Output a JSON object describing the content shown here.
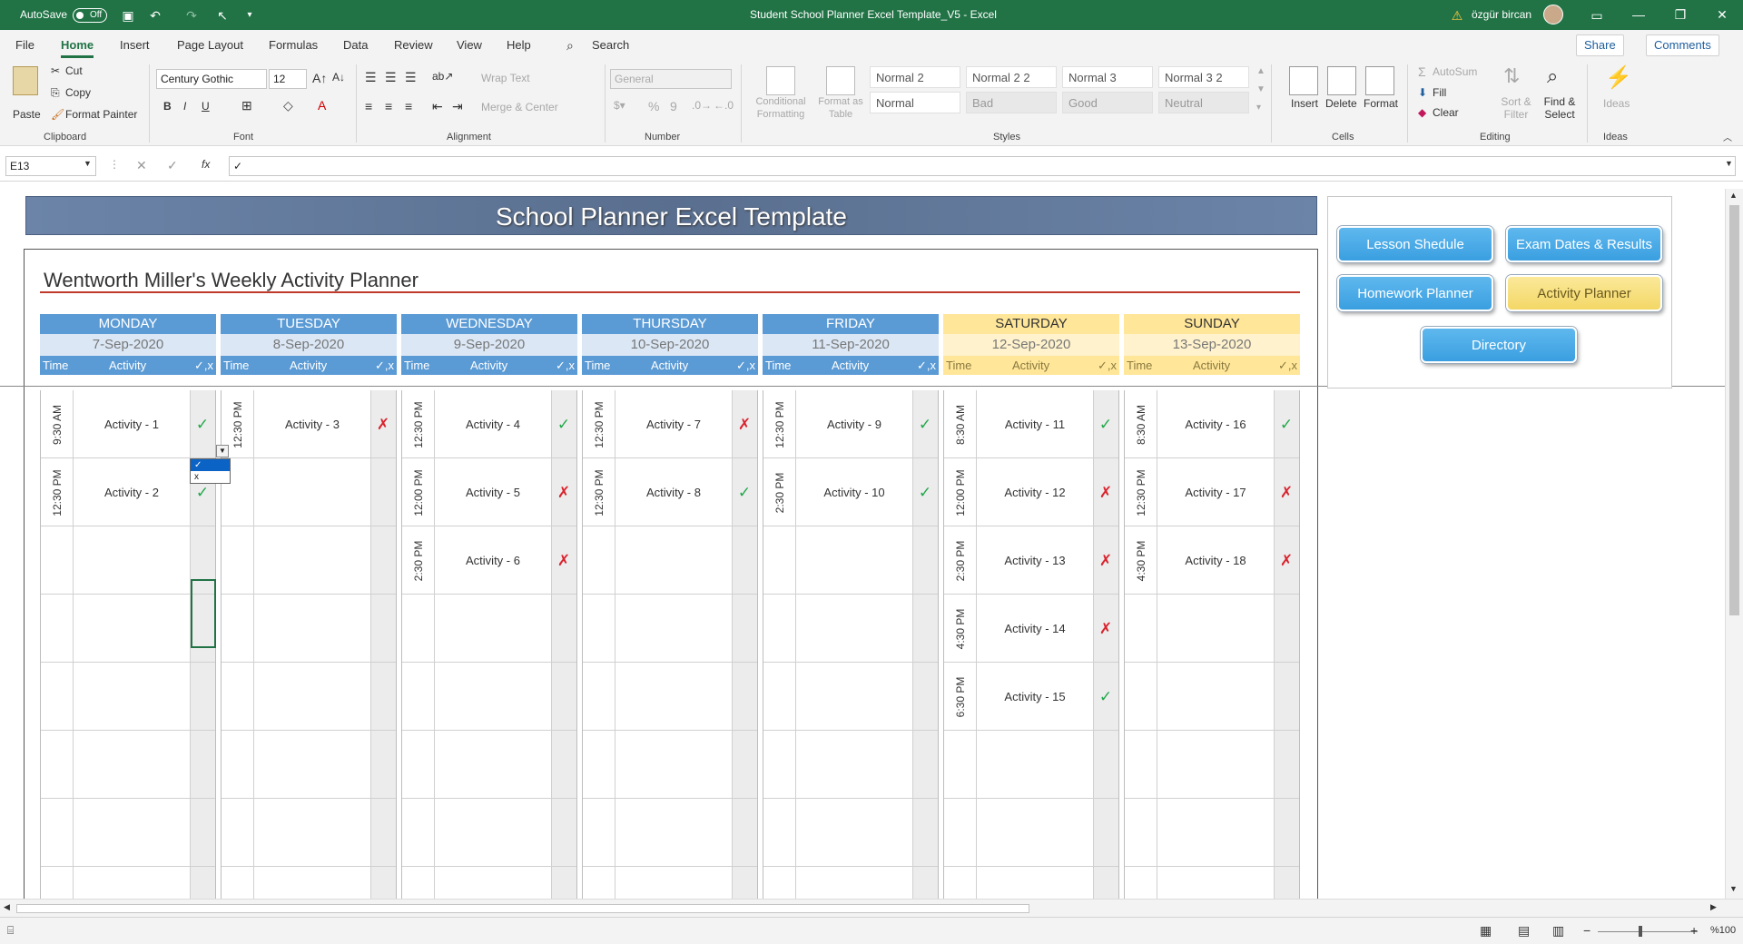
{
  "titlebar": {
    "autosave": "AutoSave",
    "toggle": "Off",
    "title": "Student School Planner Excel Template_V5  -  Excel",
    "user": "özgür bircan"
  },
  "menu": [
    "File",
    "Home",
    "Insert",
    "Page Layout",
    "Formulas",
    "Data",
    "Review",
    "View",
    "Help"
  ],
  "search": "Search",
  "share": "Share",
  "comments": "Comments",
  "ribbon": {
    "clipboard": {
      "paste": "Paste",
      "cut": "Cut",
      "copy": "Copy",
      "painter": "Format Painter",
      "label": "Clipboard"
    },
    "font": {
      "name": "Century Gothic",
      "size": "12",
      "label": "Font",
      "bold": "B",
      "italic": "I",
      "underline": "U"
    },
    "alignment": {
      "wrap": "Wrap Text",
      "merge": "Merge & Center",
      "label": "Alignment"
    },
    "number": {
      "format": "General",
      "label": "Number",
      "percent": "%",
      "comma": "9"
    },
    "cond": "Conditional Formatting",
    "fmt_table": "Format as Table",
    "styles": {
      "label": "Styles",
      "items": [
        "Normal 2",
        "Normal 2 2",
        "Normal 3",
        "Normal 3 2",
        "Normal",
        "Bad",
        "Good",
        "Neutral"
      ]
    },
    "cells": {
      "label": "Cells",
      "insert": "Insert",
      "delete": "Delete",
      "format": "Format"
    },
    "editing": {
      "label": "Editing",
      "autosum": "AutoSum",
      "fill": "Fill",
      "clear": "Clear",
      "sort": "Sort & Filter",
      "find": "Find & Select"
    },
    "ideas": {
      "label": "Ideas",
      "btn": "Ideas"
    }
  },
  "formula": {
    "namebox": "E13",
    "content": "✓",
    "fx": "fx"
  },
  "sheet": {
    "banner": "School Planner Excel Template",
    "planner_title": "Wentworth Miller's Weekly Activity Planner",
    "sub": {
      "time": "Time",
      "activity": "Activity",
      "check": "✓,x"
    },
    "days": [
      {
        "name": "MONDAY",
        "date": "7-Sep-2020",
        "weekend": false,
        "rows": [
          {
            "time": "9:30 AM",
            "act": "Activity - 1",
            "mark": "✓"
          },
          {
            "time": "12:30 PM",
            "act": "Activity - 2",
            "mark": "✓"
          }
        ]
      },
      {
        "name": "TUESDAY",
        "date": "8-Sep-2020",
        "weekend": false,
        "rows": [
          {
            "time": "12:30 PM",
            "act": "Activity - 3",
            "mark": "✗"
          }
        ]
      },
      {
        "name": "WEDNESDAY",
        "date": "9-Sep-2020",
        "weekend": false,
        "rows": [
          {
            "time": "12:30 PM",
            "act": "Activity - 4",
            "mark": "✓"
          },
          {
            "time": "12:00 PM",
            "act": "Activity - 5",
            "mark": "✗"
          },
          {
            "time": "2:30 PM",
            "act": "Activity - 6",
            "mark": "✗"
          }
        ]
      },
      {
        "name": "THURSDAY",
        "date": "10-Sep-2020",
        "weekend": false,
        "rows": [
          {
            "time": "12:30 PM",
            "act": "Activity - 7",
            "mark": "✗"
          },
          {
            "time": "12:30 PM",
            "act": "Activity - 8",
            "mark": "✓"
          }
        ]
      },
      {
        "name": "FRIDAY",
        "date": "11-Sep-2020",
        "weekend": false,
        "rows": [
          {
            "time": "12:30 PM",
            "act": "Activity - 9",
            "mark": "✓"
          },
          {
            "time": "2:30 PM",
            "act": "Activity - 10",
            "mark": "✓"
          }
        ]
      },
      {
        "name": "SATURDAY",
        "date": "12-Sep-2020",
        "weekend": true,
        "rows": [
          {
            "time": "8:30 AM",
            "act": "Activity - 11",
            "mark": "✓"
          },
          {
            "time": "12:00 PM",
            "act": "Activity - 12",
            "mark": "✗"
          },
          {
            "time": "2:30 PM",
            "act": "Activity - 13",
            "mark": "✗"
          },
          {
            "time": "4:30 PM",
            "act": "Activity - 14",
            "mark": "✗"
          },
          {
            "time": "6:30 PM",
            "act": "Activity - 15",
            "mark": "✓"
          }
        ]
      },
      {
        "name": "SUNDAY",
        "date": "13-Sep-2020",
        "weekend": true,
        "rows": [
          {
            "time": "8:30 AM",
            "act": "Activity - 16",
            "mark": "✓"
          },
          {
            "time": "12:30 PM",
            "act": "Activity - 17",
            "mark": "✗"
          },
          {
            "time": "4:30 PM",
            "act": "Activity - 18",
            "mark": "✗"
          }
        ]
      }
    ],
    "nav": {
      "lesson": "Lesson Shedule",
      "exam": "Exam Dates & Results",
      "homework": "Homework Planner",
      "activity": "Activity Planner",
      "directory": "Directory"
    },
    "dropdown": [
      "✓",
      "x"
    ]
  },
  "status": {
    "zoom": "%100",
    "minus": "−",
    "plus": "+"
  }
}
